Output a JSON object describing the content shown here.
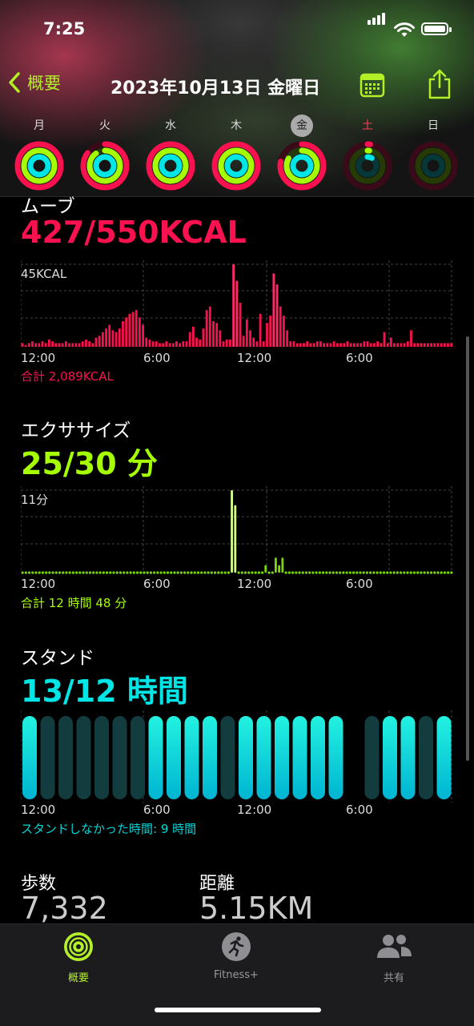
{
  "status": {
    "time": "7:25"
  },
  "nav": {
    "back_label": "概要",
    "title": "2023年10月13日 金曜日"
  },
  "week": [
    {
      "label": "月",
      "move": 1.0,
      "exercise": 1.0,
      "stand": 1.0
    },
    {
      "label": "火",
      "move": 0.85,
      "exercise": 0.9,
      "stand": 1.0
    },
    {
      "label": "水",
      "move": 1.0,
      "exercise": 1.0,
      "stand": 1.0
    },
    {
      "label": "木",
      "move": 1.0,
      "exercise": 1.0,
      "stand": 1.0
    },
    {
      "label": "金",
      "move": 0.78,
      "exercise": 0.83,
      "stand": 1.0,
      "selected": true
    },
    {
      "label": "土",
      "move": 0.02,
      "exercise": 0.02,
      "stand": 0.08
    },
    {
      "label": "日",
      "move": 0,
      "exercise": 0,
      "stand": 0
    }
  ],
  "move": {
    "title": "ムーブ",
    "value": "427/550KCAL",
    "max_label": "45KCAL",
    "total": "合計 2,089KCAL",
    "color": "#fa114f",
    "bars": [
      2,
      1,
      2,
      3,
      2,
      2,
      3,
      2,
      4,
      3,
      2,
      2,
      2,
      3,
      2,
      2,
      2,
      2,
      3,
      4,
      3,
      2,
      5,
      6,
      8,
      10,
      12,
      9,
      8,
      10,
      14,
      16,
      18,
      19,
      20,
      16,
      12,
      5,
      4,
      3,
      3,
      2,
      2,
      3,
      2,
      2,
      3,
      2,
      3,
      3,
      8,
      11,
      5,
      4,
      10,
      20,
      22,
      14,
      13,
      9,
      3,
      4,
      4,
      45,
      36,
      24,
      6,
      15,
      9,
      5,
      3,
      18,
      3,
      13,
      17,
      40,
      34,
      22,
      17,
      9,
      3,
      3,
      2,
      2,
      2,
      3,
      2,
      2,
      3,
      3,
      2,
      2,
      2,
      3,
      2,
      2,
      2,
      3,
      2,
      2,
      2,
      2,
      3,
      3,
      2,
      2,
      3,
      2,
      8,
      2,
      5,
      2,
      2,
      2,
      2,
      3,
      9,
      2,
      2,
      2,
      2,
      2,
      2,
      2,
      2,
      2,
      2,
      2,
      2
    ]
  },
  "exercise": {
    "title": "エクササイズ",
    "value": "25/30 分",
    "max_label": "11分",
    "total": "合計 12 時間 48 分",
    "color": "#a6ff00",
    "bars": [
      0,
      0,
      0,
      0,
      0,
      0,
      0,
      0,
      0,
      0,
      0,
      0,
      0,
      0,
      0,
      0,
      0,
      0,
      0,
      0,
      0,
      0,
      0,
      0,
      0,
      0,
      0,
      0,
      0,
      0,
      0,
      0,
      0,
      0,
      0,
      0,
      0,
      0,
      0,
      0,
      0,
      0,
      0,
      0,
      0,
      0,
      0,
      0,
      0,
      0,
      0,
      0,
      0,
      0,
      0,
      0,
      0,
      0,
      0,
      0,
      0,
      0,
      11,
      9,
      0,
      0,
      0,
      0,
      0,
      0,
      0,
      0,
      1,
      0,
      0,
      2,
      1,
      2,
      0,
      0,
      0,
      0,
      0,
      0,
      0,
      0,
      0,
      0,
      0,
      0,
      0,
      0,
      0,
      0,
      0,
      0,
      0,
      0,
      0,
      0,
      0,
      0,
      0,
      0,
      0,
      0,
      0,
      0,
      0,
      0,
      0,
      0,
      0,
      0,
      0,
      0,
      0,
      0,
      0,
      0,
      0,
      0,
      0,
      0,
      0,
      0,
      0,
      0
    ]
  },
  "stand": {
    "title": "スタンド",
    "value": "13/12 時間",
    "total": "スタンドしなかった時間: 9 時間",
    "color": "#00d7d8",
    "hours": [
      1,
      0,
      0,
      0,
      0,
      0,
      0,
      1,
      1,
      1,
      1,
      0,
      1,
      1,
      1,
      1,
      1,
      1,
      null,
      0,
      1,
      1,
      0,
      1
    ]
  },
  "xaxis": [
    "12:00",
    "6:00",
    "12:00",
    "6:00"
  ],
  "steps": {
    "label": "歩数",
    "value": "7,332"
  },
  "distance": {
    "label": "距離",
    "value": "5.15KM"
  },
  "tabs": [
    {
      "label": "概要",
      "icon": "activity-rings-icon",
      "active": true
    },
    {
      "label": "Fitness+",
      "icon": "runner-icon"
    },
    {
      "label": "共有",
      "icon": "people-icon"
    }
  ],
  "colors": {
    "accent": "#b4f028"
  }
}
